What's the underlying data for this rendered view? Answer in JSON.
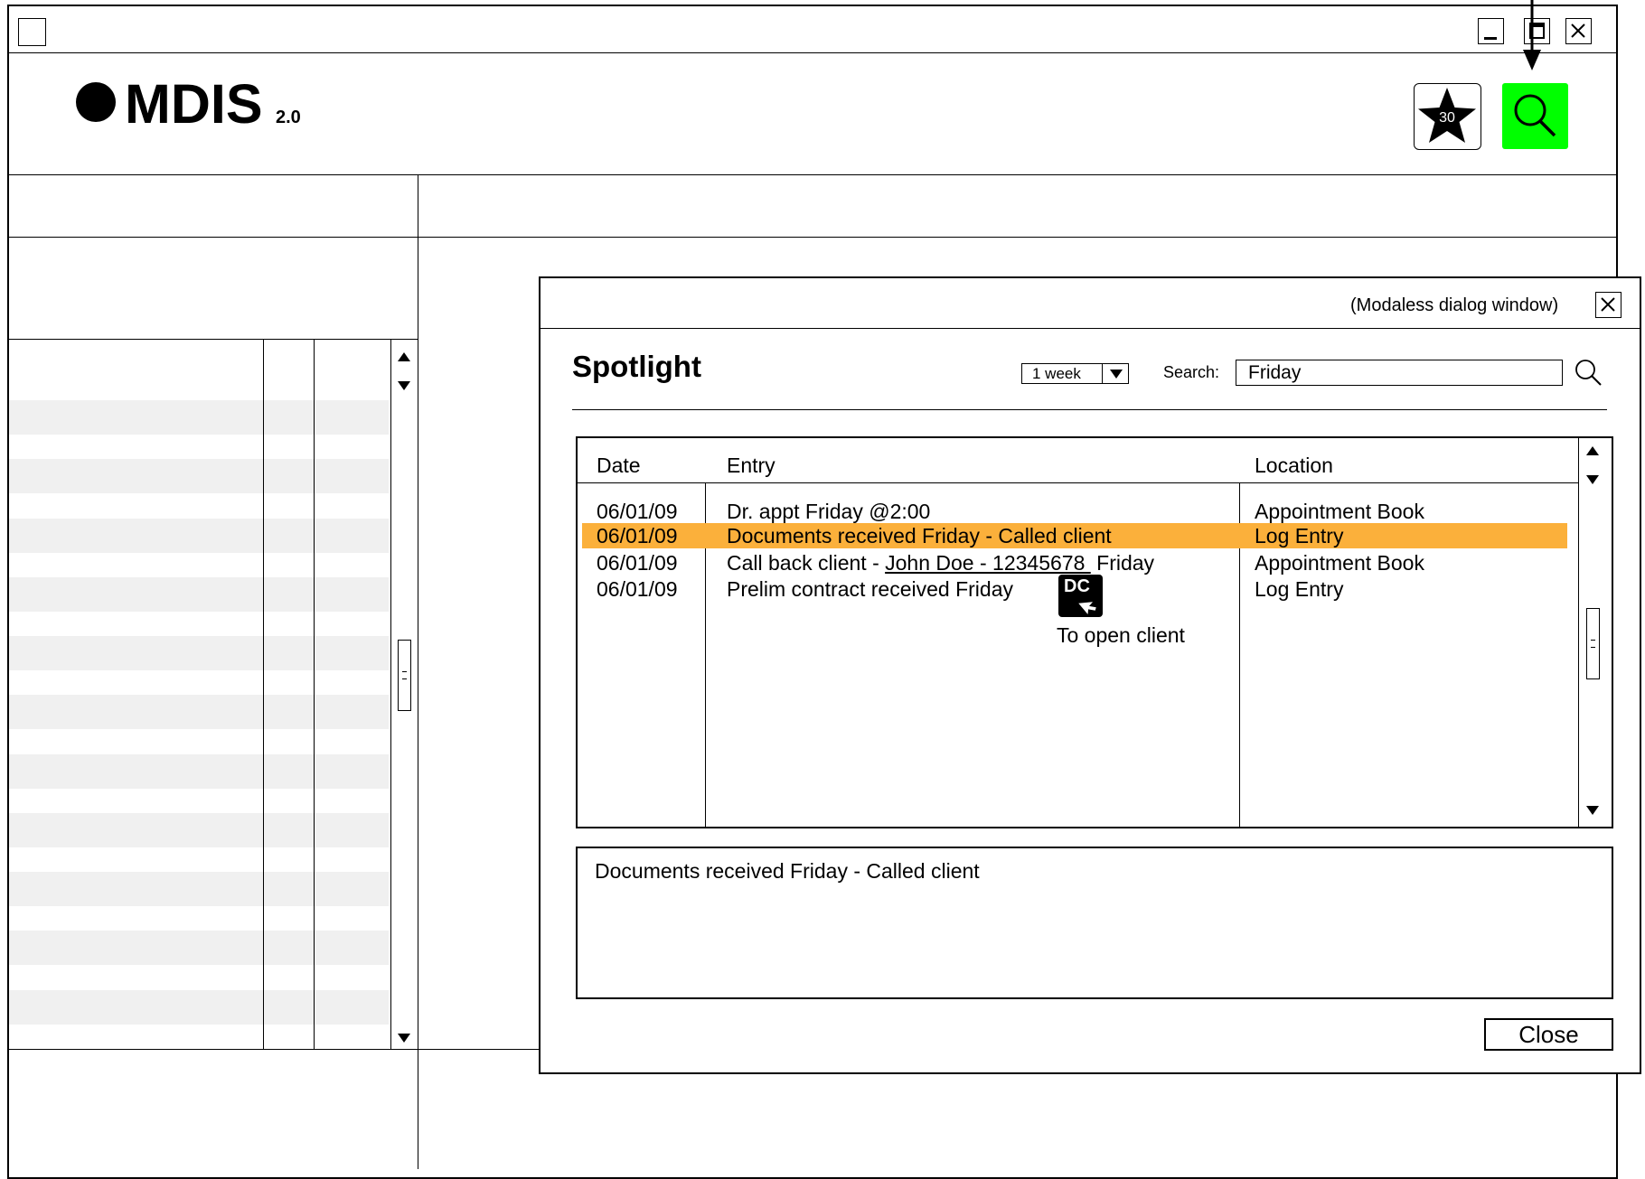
{
  "app": {
    "name": "MDIS",
    "version": "2.0",
    "favorites_count": "30"
  },
  "dialog": {
    "note": "(Modaless dialog window)",
    "title": "Spotlight",
    "period_select": {
      "selected": "1 week"
    },
    "search_label": "Search:",
    "search_value": "Friday",
    "columns": [
      "Date",
      "Entry",
      "Location"
    ],
    "rows": [
      {
        "date": "06/01/09",
        "entry": "Dr. appt Friday @2:00",
        "location": "Appointment Book",
        "selected": false
      },
      {
        "date": "06/01/09",
        "entry": "Documents received Friday - Called client",
        "location": "Log Entry",
        "selected": true
      },
      {
        "date": "06/01/09",
        "entry_prefix": "Call back client - ",
        "entry_link": "John Doe - 12345678 ",
        "entry_suffix": " Friday",
        "location": "Appointment Book",
        "selected": false
      },
      {
        "date": "06/01/09",
        "entry": "Prelim contract received Friday",
        "location": "Log Entry",
        "selected": false
      }
    ],
    "dc_hint": {
      "badge": "DC",
      "text": "To open client"
    },
    "detail_text": "Documents received Friday - Called client",
    "close_label": "Close"
  },
  "colors": {
    "highlight": "#fbb03b",
    "search_button": "#00ff00",
    "stripe": "#f0f0f0"
  }
}
